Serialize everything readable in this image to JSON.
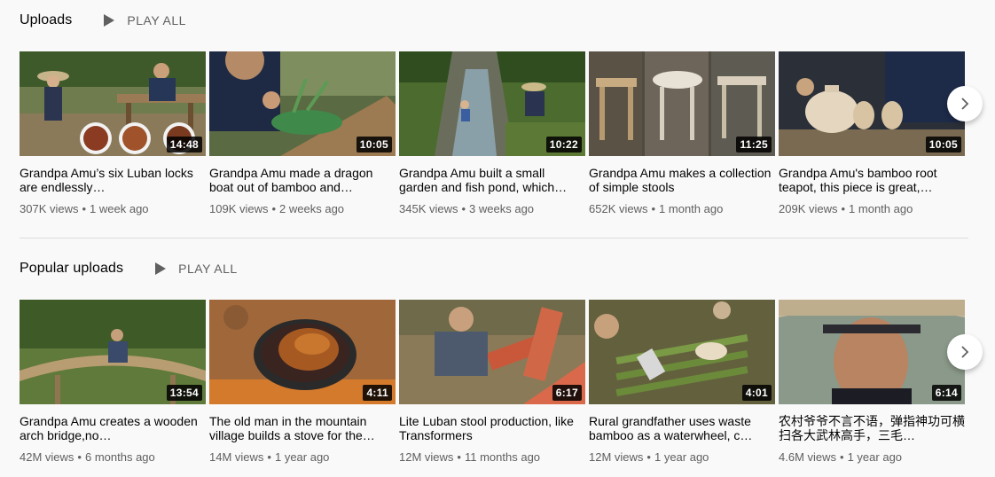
{
  "shelves": [
    {
      "title": "Uploads",
      "play_all": "PLAY ALL",
      "videos": [
        {
          "title": "Grandpa Amu’s six Luban locks are endlessly…",
          "duration": "14:48",
          "views": "307K views",
          "age": "1 week ago"
        },
        {
          "title": "Grandpa Amu made a dragon boat out of bamboo and…",
          "duration": "10:05",
          "views": "109K views",
          "age": "2 weeks ago"
        },
        {
          "title": "Grandpa Amu built a small garden and fish pond, which…",
          "duration": "10:22",
          "views": "345K views",
          "age": "3 weeks ago"
        },
        {
          "title": "Grandpa Amu makes a collection of simple stools",
          "duration": "11:25",
          "views": "652K views",
          "age": "1 month ago"
        },
        {
          "title": "Grandpa Amu's bamboo root teapot, this piece is great,…",
          "duration": "10:05",
          "views": "209K views",
          "age": "1 month ago"
        }
      ]
    },
    {
      "title": "Popular uploads",
      "play_all": "PLAY ALL",
      "videos": [
        {
          "title": "Grandpa Amu creates a wooden arch bridge,no…",
          "duration": "13:54",
          "views": "42M views",
          "age": "6 months ago"
        },
        {
          "title": "The old man in the mountain village builds a stove for the…",
          "duration": "4:11",
          "views": "14M views",
          "age": "1 year ago"
        },
        {
          "title": "Lite Luban stool production, like Transformers",
          "duration": "6:17",
          "views": "12M views",
          "age": "11 months ago"
        },
        {
          "title": "Rural grandfather uses waste bamboo as a waterwheel, c…",
          "duration": "4:01",
          "views": "12M views",
          "age": "1 year ago"
        },
        {
          "title": "农村爷爷不言不语，弹指神功可横扫各大武林高手，三毛…",
          "duration": "6:14",
          "views": "4.6M views",
          "age": "1 year ago"
        }
      ]
    }
  ],
  "meta_separator": "•",
  "icons": {
    "play_all": "play-icon",
    "next": "chevron-right-icon"
  }
}
